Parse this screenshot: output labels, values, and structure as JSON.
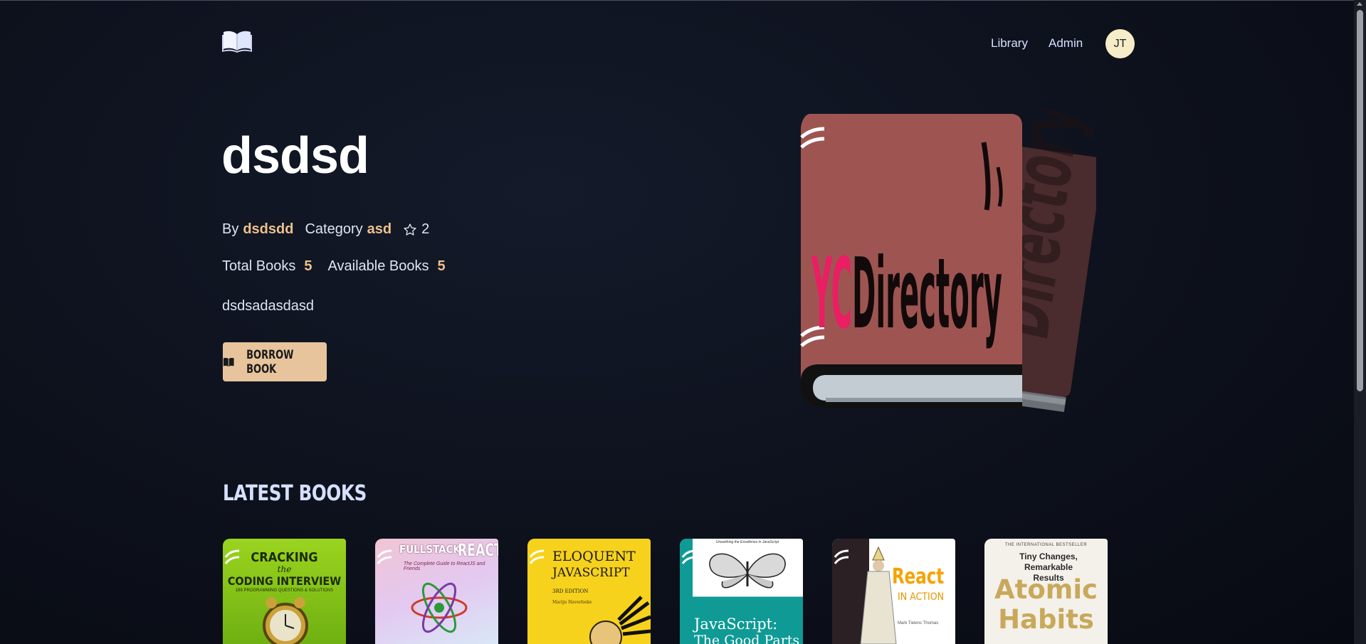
{
  "header": {
    "logo_icon": "open-book-icon",
    "nav": [
      {
        "label": "Library"
      },
      {
        "label": "Admin"
      }
    ],
    "avatar_initials": "JT"
  },
  "book": {
    "title": "dsdsd",
    "by_label": "By",
    "author": "dsdsdd",
    "category_label": "Category",
    "category": "asd",
    "rating_icon": "star-icon",
    "rating": "2",
    "total_label": "Total Books",
    "total": "5",
    "available_label": "Available Books",
    "available": "5",
    "description": "dsdsadasdasd",
    "borrow_label": "BORROW BOOK",
    "borrow_icon": "book-icon",
    "cover_color": "#9e5552",
    "cover_text_accent": "YC",
    "cover_text_main": "Directory"
  },
  "latest": {
    "title": "LATEST BOOKS",
    "books": [
      {
        "title_line1": "CRACKING",
        "title_line2": "the",
        "title_line3": "CODING INTERVIEW",
        "subtitle": "189 PROGRAMMING QUESTIONS & SOLUTIONS",
        "bg": "#8bc91a"
      },
      {
        "title_line1": "FULLSTACK",
        "title_line2": "REACT",
        "subtitle": "The Complete Guide to ReactJS and Friends",
        "bg": "#e9b8c8"
      },
      {
        "title_line1": "ELOQUENT",
        "title_line2": "JAVASCRIPT",
        "subtitle": "3RD EDITION",
        "author": "Marijn Haverbeke",
        "bg": "#f7d21c"
      },
      {
        "tagline": "Unearthing the Excellence in JavaScript",
        "title_line1": "JavaScript:",
        "title_line2": "The Good Parts",
        "bg": "#0f9a95"
      },
      {
        "title_line1": "React",
        "title_line2": "IN ACTION",
        "author": "Mark Tielens Thomas",
        "bg": "#ffffff"
      },
      {
        "tagline": "THE INTERNATIONAL BESTSELLER",
        "subtitle": "Tiny Changes, Remarkable Results",
        "title_line1": "Atomic",
        "title_line2": "Habits",
        "bg": "#f4f1ea"
      }
    ]
  }
}
